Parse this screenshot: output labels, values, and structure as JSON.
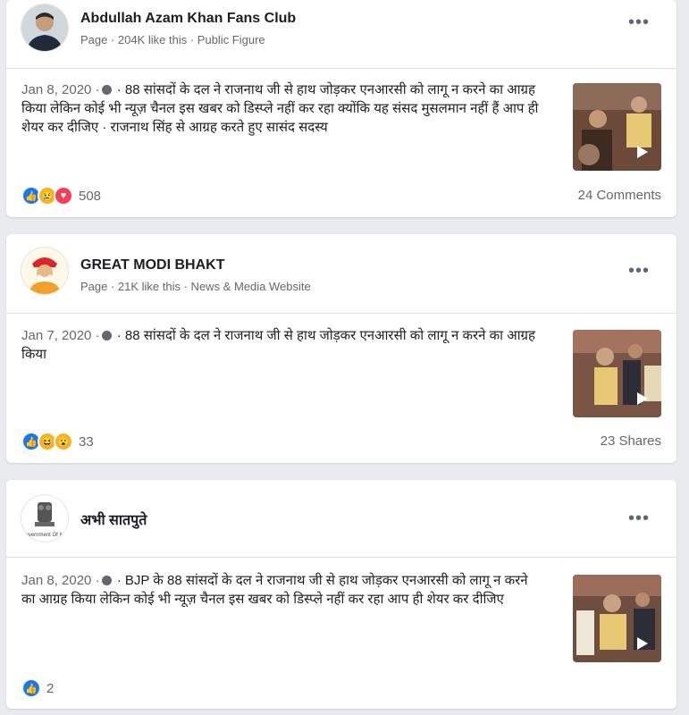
{
  "posts": [
    {
      "page_name": "Abdullah Azam Khan Fans Club",
      "meta": "Page · 204K like this · Public Figure",
      "date": "Jan 8, 2020 ·",
      "text": " · 88 सांसदों के दल ने राजनाथ जी से हाथ जोड़कर एनआरसी को लागू न करने का आग्रह किया लेकिन कोई भी न्यूज़ चैनल इस खबर को डिस्प्ले नहीं कर रहा क्योंकि यह संसद मुसलमान नहीं हैं आप ही शेयर कर दीजिए · राजनाथ सिंह से आग्रह करते हुए सासंद सदस्य",
      "reactions": [
        "like",
        "sad",
        "love"
      ],
      "reaction_count": "508",
      "right_stat": "24 Comments"
    },
    {
      "page_name": "GREAT MODI BHAKT",
      "meta": "Page · 21K like this · News & Media Website",
      "date": "Jan 7, 2020 ·",
      "text": " · 88 सांसदों के दल ने राजनाथ जी से हाथ जोड़कर एनआरसी को लागू न करने का आग्रह किया",
      "reactions": [
        "like",
        "haha",
        "wow"
      ],
      "reaction_count": "33",
      "right_stat": "23 Shares"
    },
    {
      "page_name": "अभी सातपुते",
      "meta": "",
      "date": "Jan 8, 2020 ·",
      "text": " · BJP के 88 सांसदों के दल ने राजनाथ जी से हाथ जोड़कर एनआरसी को लागू न करने का आग्रह किया लेकिन कोई भी न्यूज़ चैनल इस खबर को डिस्प्ले नहीं कर रहा आप ही शेयर कर दीजिए",
      "reactions": [
        "like"
      ],
      "reaction_count": "2",
      "right_stat": ""
    }
  ],
  "icons": {
    "more": "more-options-icon",
    "globe": "globe-icon",
    "play": "play-icon",
    "emblem_text": "overnment Of In"
  },
  "colors": {
    "like": "#1877f2",
    "love": "#f33e58",
    "sad_haha_wow": "#f7b125"
  }
}
